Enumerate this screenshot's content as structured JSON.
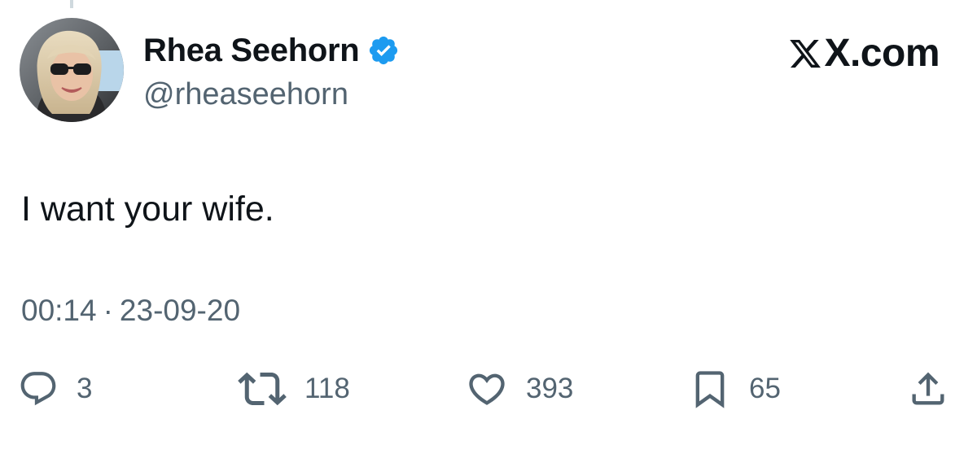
{
  "tweet": {
    "author": {
      "display_name": "Rhea Seehorn",
      "handle": "@rheaseehorn",
      "verified": true,
      "avatar_icon": "profile-photo"
    },
    "brand": {
      "label": "X.com",
      "icon": "x-logo-icon"
    },
    "text": "I want your wife.",
    "time": "00:14",
    "separator": "·",
    "date": "23-09-20",
    "actions": {
      "replies": "3",
      "reposts": "118",
      "likes": "393",
      "bookmarks": "65"
    }
  },
  "colors": {
    "text_primary": "#0f1419",
    "text_secondary": "#536471",
    "verified_blue": "#1d9bf0",
    "background": "#ffffff"
  }
}
